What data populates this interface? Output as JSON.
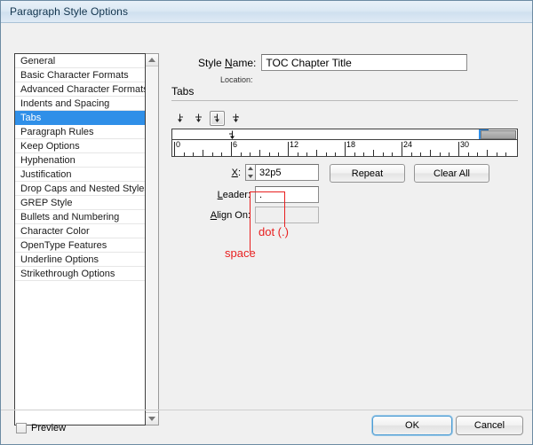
{
  "window": {
    "title": "Paragraph Style Options"
  },
  "sidebar": {
    "items": [
      {
        "label": "General",
        "selected": false
      },
      {
        "label": "Basic Character Formats",
        "selected": false
      },
      {
        "label": "Advanced Character Formats",
        "selected": false
      },
      {
        "label": "Indents and Spacing",
        "selected": false
      },
      {
        "label": "Tabs",
        "selected": true
      },
      {
        "label": "Paragraph Rules",
        "selected": false
      },
      {
        "label": "Keep Options",
        "selected": false
      },
      {
        "label": "Hyphenation",
        "selected": false
      },
      {
        "label": "Justification",
        "selected": false
      },
      {
        "label": "Drop Caps and Nested Styles",
        "selected": false
      },
      {
        "label": "GREP Style",
        "selected": false
      },
      {
        "label": "Bullets and Numbering",
        "selected": false
      },
      {
        "label": "Character Color",
        "selected": false
      },
      {
        "label": "OpenType Features",
        "selected": false
      },
      {
        "label": "Underline Options",
        "selected": false
      },
      {
        "label": "Strikethrough Options",
        "selected": false
      }
    ]
  },
  "style_name": {
    "label_before": "Style ",
    "label_accel": "N",
    "label_after": "ame:",
    "value": "TOC Chapter Title",
    "placeholder": ""
  },
  "location": {
    "label": "Location:",
    "value": ""
  },
  "section": {
    "title": "Tabs"
  },
  "tab_align_buttons": [
    {
      "name": "left-tab-icon",
      "glyph": "↓",
      "selected": false
    },
    {
      "name": "center-tab-icon",
      "glyph": "↓",
      "selected": false
    },
    {
      "name": "right-tab-icon",
      "glyph": "↓",
      "selected": true
    },
    {
      "name": "decimal-tab-icon",
      "glyph": "↓",
      "selected": false
    }
  ],
  "ruler": {
    "tick_labels": [
      "0",
      "6",
      "12",
      "18",
      "24",
      "30"
    ],
    "tab_marker_glyph": "↓",
    "selected_marker_glyph": "↓"
  },
  "fields": {
    "x": {
      "label_accel": "X",
      "label_after": ":",
      "value": "32p5",
      "placeholder": ""
    },
    "leader": {
      "label_accel": "L",
      "label_after": "eader:",
      "value": ". ",
      "placeholder": ""
    },
    "align_on": {
      "label_accel": "A",
      "label_after": "lign On:",
      "value": "",
      "placeholder": ""
    }
  },
  "buttons": {
    "repeat": "Repeat",
    "clear_all": "Clear All",
    "ok": "OK",
    "cancel": "Cancel"
  },
  "preview": {
    "label": "Preview",
    "checked": false
  },
  "annotations": [
    {
      "text": "dot (.)"
    },
    {
      "text": "space"
    }
  ],
  "colors": {
    "selection_blue": "#2f8fe8",
    "annotation_red": "#e81f1f",
    "title_text": "#12344d"
  }
}
